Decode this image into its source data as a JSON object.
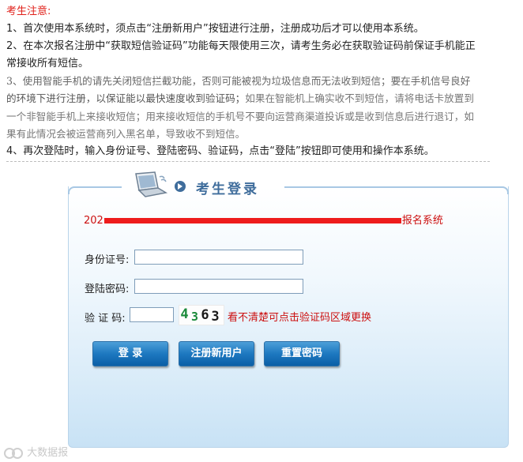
{
  "notice": {
    "title": "考生注意:",
    "line1": "1、首次使用本系统时，须点击“注册新用户”按钮进行注册，注册成功后才可以使用本系统。",
    "line2a": "2、在本次报名注册中“获取短信验证码”功能每天限使用三次，请考生务必在获取验证码前保证手机能正",
    "line2b": "常接收所有短信。",
    "line3a": "3、使用智能手机的请先关闭短信拦截功能，否则可能被视为垃圾信息而无法收到短信；要在手机信号良好",
    "line3b_dark": "的环境下进行注册，以保证能以最快速度收到验证码；",
    "line3b_gray": "如果在智能机上确实收不到短信，请将电话卡放置到",
    "line3c": "一个非智能手机上来接收短信；用来接收短信的手机号不要向运营商渠道投诉或是收到信息后进行退订，如",
    "line3d": "果有此情况会被运营商列入黑名单，导致收不到短信。",
    "line4": "4、再次登陆时，输入身份证号、登陆密码、验证码，点击“登陆”按钮即可使用和操作本系统。"
  },
  "login": {
    "title": "考生登录",
    "system_prefix": "202",
    "system_suffix": "报名系统",
    "id_label": "身份证号:",
    "password_label": "登陆密码:",
    "captcha_label": "验 证 码:",
    "captcha_chars": [
      "4",
      "3",
      "6",
      "3"
    ],
    "captcha_hint": "看不清楚可点击验证码区域更换",
    "login_button": "登 录",
    "register_button": "注册新用户",
    "reset_button": "重置密码"
  },
  "colors": {
    "notice_title": "#e0201a",
    "accent_blue": "#3f6d9c",
    "button_blue": "#1d78c0",
    "hint_red": "#cc1010",
    "captcha_green": "#1a8a3a",
    "captcha_dark": "#1a1a1a"
  },
  "watermark": {
    "text": "大数据报"
  }
}
